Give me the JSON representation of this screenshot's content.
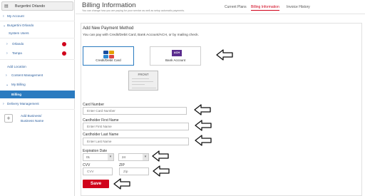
{
  "sidebar": {
    "org_name": "Burgertini Orlando",
    "items": [
      {
        "label": "My Account"
      },
      {
        "label": "Burgertini Orlando"
      },
      {
        "label": "System Users"
      },
      {
        "label": "Orlando"
      },
      {
        "label": "Tampa"
      },
      {
        "label": "Add Location"
      },
      {
        "label": "Content Management"
      },
      {
        "label": "My Billing"
      },
      {
        "label": "Billing"
      },
      {
        "label": "Delivery Management"
      }
    ],
    "add_business_line1": "Add Business/",
    "add_business_line2": "Business Name"
  },
  "header": {
    "title": "Billing Information",
    "subtitle": "You can change how you are paying for your service as well as setup automatic payments.",
    "tabs": [
      {
        "label": "Current Plans"
      },
      {
        "label": "Billing Information"
      },
      {
        "label": "Invoice History"
      }
    ]
  },
  "form": {
    "section_title": "Add New Payment Method",
    "description": "You can pay with Credit/Debit Card, Bank Account/ACH, or by mailing check.",
    "payment_options": [
      {
        "label": "Credit/Debit Card",
        "selected": true
      },
      {
        "label": "Bank Account",
        "badge": "ACH"
      }
    ],
    "check_image_label": "FRONT",
    "card_number_label": "Card Number",
    "card_number_placeholder": "Enter Card Number",
    "first_name_label": "Cardholder First Name",
    "first_name_placeholder": "Enter First Name",
    "last_name_label": "Cardholder Last Name",
    "last_name_placeholder": "Enter Last Name",
    "expiration_label": "Expiration Date",
    "exp_month": "01",
    "exp_year": "24",
    "cvv_label": "CVV",
    "cvv_placeholder": "CVV",
    "zip_label": "ZIP",
    "zip_placeholder": "Zip",
    "save_label": "Save"
  },
  "colors": {
    "accent_red": "#d0021b",
    "active_blue": "#2b7bc0",
    "link_blue": "#2b5e9e",
    "ach_purple": "#5b2d8e"
  },
  "icons": [
    "store-icon",
    "chevron-right-icon",
    "chevron-down-icon",
    "status-dot-icon",
    "plus-icon",
    "credit-card-icon",
    "ach-icon",
    "arrow-left-icon"
  ]
}
